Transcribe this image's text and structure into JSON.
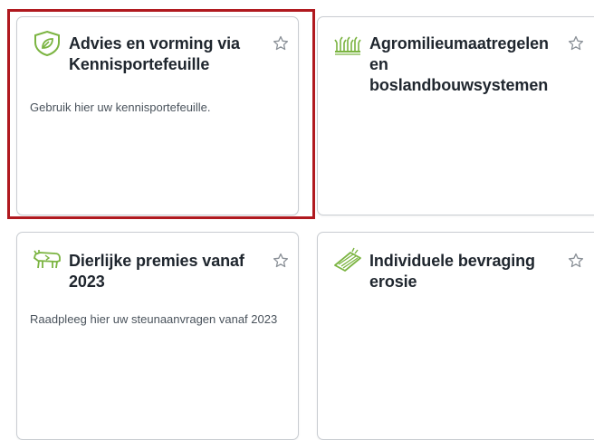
{
  "cards": [
    {
      "title": "Advies en vorming via Kennisportefeuille",
      "description": "Gebruik hier uw kennisportefeuille.",
      "icon": "shield-leaf-icon"
    },
    {
      "title": "Agromilieumaatregelen en boslandbouwsystemen",
      "description": "",
      "icon": "crops-field-icon"
    },
    {
      "title": "Dierlijke premies vanaf 2023",
      "description": "Raadpleeg hier uw steunaanvragen vanaf 2023",
      "icon": "cow-icon"
    },
    {
      "title": "Individuele bevraging erosie",
      "description": "",
      "icon": "sloped-field-icon"
    }
  ],
  "colors": {
    "highlight": "#b0191f",
    "icon_green": "#7bb441",
    "star": "#8a9097",
    "title": "#1f262e",
    "text": "#4a535c"
  }
}
